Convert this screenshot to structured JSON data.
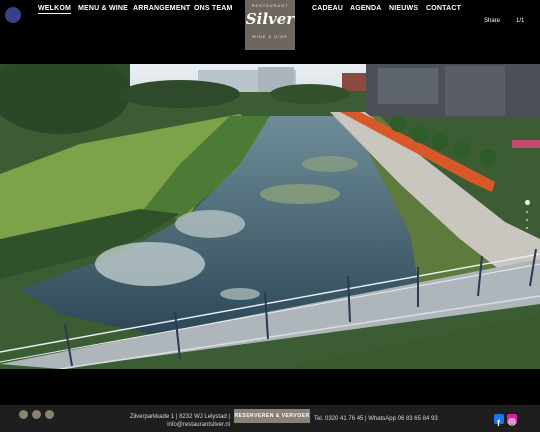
{
  "nav": {
    "items": [
      {
        "label": "WELKOM",
        "active": true
      },
      {
        "label": "MENU & WINE"
      },
      {
        "label": "ARRANGEMENT"
      },
      {
        "label": "ONS TEAM"
      },
      {
        "label": "CADEAU"
      },
      {
        "label": "AGENDA"
      },
      {
        "label": "NIEUWS"
      },
      {
        "label": "CONTACT"
      }
    ]
  },
  "logo": {
    "top": "RESTAURANT",
    "main": "Silver",
    "bottom": "WINE & DINE"
  },
  "gallery": {
    "share_label": "Share",
    "counter": "1/1",
    "slide_count": 4,
    "active_slide": 1,
    "image_icon": "aerial-canal-photo"
  },
  "footer": {
    "address_line1": "Zilverparkkade 1  |  8232 WJ Lelystad  |",
    "address_line2": "info@restaurantsilver.nl",
    "reserve_button": "RESERVEREN & VERVOER",
    "contact": "Tel. 0320 41 76 45  |  WhatsApp 06 83 65 84 93",
    "colors": {
      "facebook": "#1877f2",
      "instagram": "#d6249f",
      "badge": "#8c8270"
    }
  }
}
